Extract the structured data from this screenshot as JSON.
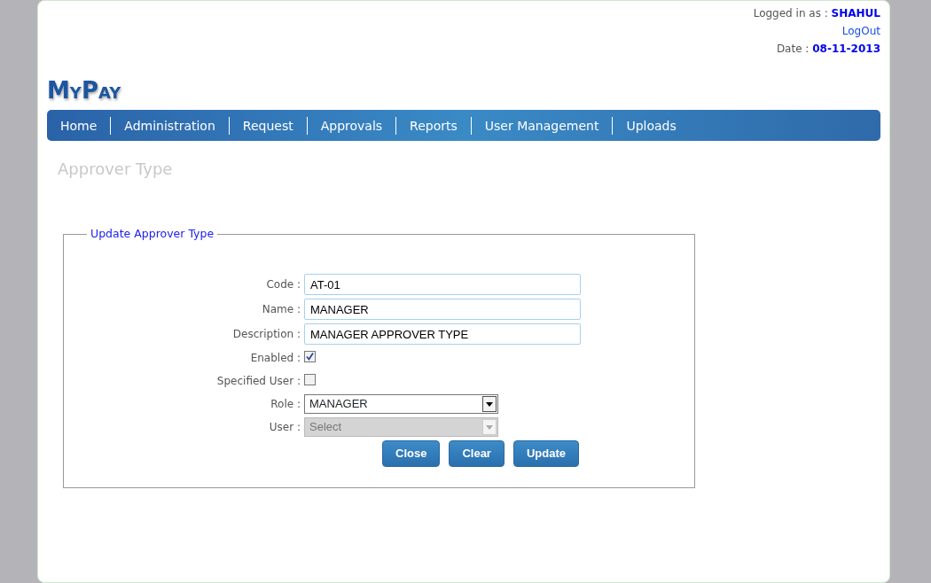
{
  "header": {
    "logged_in_label": "Logged in as :",
    "user": "SHAHUL",
    "logout": "LogOut",
    "date_label": "Date :",
    "date": "08-11-2013"
  },
  "logo": "MyPay",
  "nav": [
    {
      "label": "Home"
    },
    {
      "label": "Administration"
    },
    {
      "label": "Request"
    },
    {
      "label": "Approvals"
    },
    {
      "label": "Reports"
    },
    {
      "label": "User Management"
    },
    {
      "label": "Uploads"
    }
  ],
  "page_title": "Approver Type",
  "form": {
    "legend": "Update Approver Type",
    "fields": [
      {
        "kind": "text",
        "label": "Code :",
        "value": "AT-01"
      },
      {
        "kind": "text",
        "label": "Name :",
        "value": "MANAGER"
      },
      {
        "kind": "text",
        "label": "Description :",
        "value": "MANAGER APPROVER TYPE"
      },
      {
        "kind": "checkbox",
        "label": "Enabled :",
        "checked": true
      },
      {
        "kind": "checkbox",
        "label": "Specified User :",
        "checked": false
      },
      {
        "kind": "select",
        "label": "Role :",
        "value": "MANAGER",
        "disabled": false
      },
      {
        "kind": "select",
        "label": "User :",
        "value": "Select",
        "disabled": true
      }
    ],
    "buttons": [
      "Close",
      "Clear",
      "Update"
    ]
  }
}
